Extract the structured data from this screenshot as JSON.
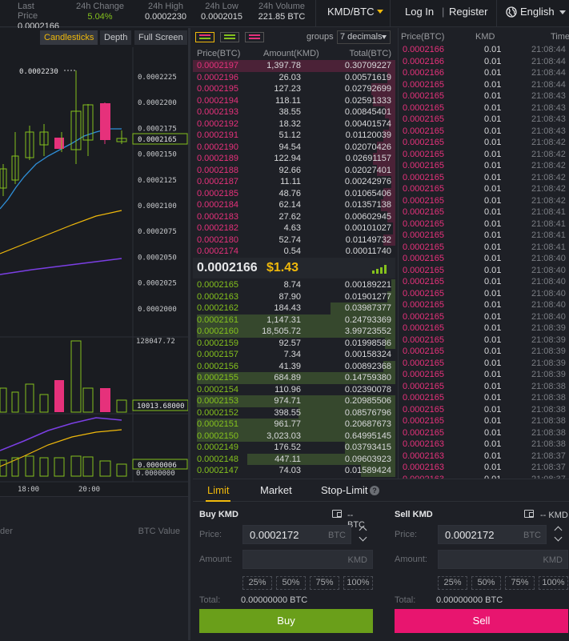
{
  "ticker": {
    "last_price_label": "Last Price",
    "last_price": "0.0002166",
    "change_label": "24h Change",
    "change": "5.04%",
    "high_label": "24h High",
    "high": "0.0002230",
    "low_label": "24h Low",
    "low": "0.0002015",
    "volume_label": "24h Volume",
    "volume": "221.85 BTC"
  },
  "pair": "KMD/BTC",
  "auth": {
    "login": "Log In",
    "separator": "|",
    "register": "Register"
  },
  "language": "English",
  "chart": {
    "toolbar": [
      "Candlesticks",
      "Depth",
      "Full Screen"
    ],
    "price_ticks": [
      "0.0002225",
      "0.0002200",
      "0.0002175",
      "0.0002150",
      "0.0002125",
      "0.0002100",
      "0.0002075",
      "0.0002050",
      "0.0002025",
      "0.0002000"
    ],
    "high_marker": "0.0002230",
    "last_marker": "0.0002165",
    "volume_max": "128047.72",
    "volume_marker": "10013.68000",
    "macd_marker": "0.0000006",
    "macd_zero": "0.0000000",
    "time_ticks": [
      "18:00",
      "20:00"
    ]
  },
  "bottom_left": {
    "col1": "der",
    "col2": "BTC Value"
  },
  "order_book": {
    "groups_label": "groups",
    "decimals": "7 decimals",
    "columns": {
      "price": "Price(BTC)",
      "amount": "Amount(KMD)",
      "total": "Total(BTC)"
    },
    "asks": [
      {
        "price": "0.0002197",
        "amount": "1,397.78",
        "total": "0.30709227",
        "depth": 1.0
      },
      {
        "price": "0.0002196",
        "amount": "26.03",
        "total": "0.00571619",
        "depth": 0.04
      },
      {
        "price": "0.0002195",
        "amount": "127.23",
        "total": "0.02792699",
        "depth": 0.12
      },
      {
        "price": "0.0002194",
        "amount": "118.11",
        "total": "0.02591333",
        "depth": 0.11
      },
      {
        "price": "0.0002193",
        "amount": "38.55",
        "total": "0.00845401",
        "depth": 0.05
      },
      {
        "price": "0.0002192",
        "amount": "18.32",
        "total": "0.00401574",
        "depth": 0.03
      },
      {
        "price": "0.0002191",
        "amount": "51.12",
        "total": "0.01120039",
        "depth": 0.06
      },
      {
        "price": "0.0002190",
        "amount": "94.54",
        "total": "0.02070426",
        "depth": 0.09
      },
      {
        "price": "0.0002189",
        "amount": "122.94",
        "total": "0.02691157",
        "depth": 0.11
      },
      {
        "price": "0.0002188",
        "amount": "92.66",
        "total": "0.02027401",
        "depth": 0.09
      },
      {
        "price": "0.0002187",
        "amount": "11.11",
        "total": "0.00242976",
        "depth": 0.02
      },
      {
        "price": "0.0002185",
        "amount": "48.76",
        "total": "0.01065406",
        "depth": 0.06
      },
      {
        "price": "0.0002184",
        "amount": "62.14",
        "total": "0.01357138",
        "depth": 0.07
      },
      {
        "price": "0.0002183",
        "amount": "27.62",
        "total": "0.00602945",
        "depth": 0.04
      },
      {
        "price": "0.0002182",
        "amount": "4.63",
        "total": "0.00101027",
        "depth": 0.01
      },
      {
        "price": "0.0002180",
        "amount": "52.74",
        "total": "0.01149732",
        "depth": 0.06
      },
      {
        "price": "0.0002174",
        "amount": "0.54",
        "total": "0.00011740",
        "depth": 0.0
      }
    ],
    "mid_price": "0.0002166",
    "mid_usd": "$1.43",
    "bids": [
      {
        "price": "0.0002165",
        "amount": "8.74",
        "total": "0.00189221",
        "depth": 0.02
      },
      {
        "price": "0.0002163",
        "amount": "87.90",
        "total": "0.01901277",
        "depth": 0.04
      },
      {
        "price": "0.0002162",
        "amount": "184.43",
        "total": "0.03987377",
        "depth": 0.32
      },
      {
        "price": "0.0002161",
        "amount": "1,147.31",
        "total": "0.24793369",
        "depth": 0.98
      },
      {
        "price": "0.0002160",
        "amount": "18,505.72",
        "total": "3.99723552",
        "depth": 0.98
      },
      {
        "price": "0.0002159",
        "amount": "92.57",
        "total": "0.01998586",
        "depth": 0.05
      },
      {
        "price": "0.0002157",
        "amount": "7.34",
        "total": "0.00158324",
        "depth": 0.0
      },
      {
        "price": "0.0002156",
        "amount": "41.39",
        "total": "0.00892368",
        "depth": 0.06
      },
      {
        "price": "0.0002155",
        "amount": "684.89",
        "total": "0.14759380",
        "depth": 0.98
      },
      {
        "price": "0.0002154",
        "amount": "110.96",
        "total": "0.02390078",
        "depth": 0.0
      },
      {
        "price": "0.0002153",
        "amount": "974.71",
        "total": "0.20985506",
        "depth": 0.98
      },
      {
        "price": "0.0002152",
        "amount": "398.55",
        "total": "0.08576796",
        "depth": 0.48
      },
      {
        "price": "0.0002151",
        "amount": "961.77",
        "total": "0.20687673",
        "depth": 0.98
      },
      {
        "price": "0.0002150",
        "amount": "3,023.03",
        "total": "0.64995145",
        "depth": 0.98
      },
      {
        "price": "0.0002149",
        "amount": "176.52",
        "total": "0.03793415",
        "depth": 0.25
      },
      {
        "price": "0.0002148",
        "amount": "447.11",
        "total": "0.09603923",
        "depth": 0.73
      },
      {
        "price": "0.0002147",
        "amount": "74.03",
        "total": "0.01589424",
        "depth": 0.17
      }
    ]
  },
  "trades": {
    "columns": {
      "price": "Price(BTC)",
      "amount": "KMD",
      "time": "Time"
    },
    "rows": [
      [
        "0.0002166",
        "0.01",
        "21:08:44"
      ],
      [
        "0.0002166",
        "0.01",
        "21:08:44"
      ],
      [
        "0.0002166",
        "0.01",
        "21:08:44"
      ],
      [
        "0.0002165",
        "0.01",
        "21:08:44"
      ],
      [
        "0.0002165",
        "0.01",
        "21:08:43"
      ],
      [
        "0.0002165",
        "0.01",
        "21:08:43"
      ],
      [
        "0.0002165",
        "0.01",
        "21:08:43"
      ],
      [
        "0.0002165",
        "0.01",
        "21:08:43"
      ],
      [
        "0.0002165",
        "0.01",
        "21:08:42"
      ],
      [
        "0.0002165",
        "0.01",
        "21:08:42"
      ],
      [
        "0.0002165",
        "0.01",
        "21:08:42"
      ],
      [
        "0.0002165",
        "0.01",
        "21:08:42"
      ],
      [
        "0.0002165",
        "0.01",
        "21:08:42"
      ],
      [
        "0.0002165",
        "0.01",
        "21:08:42"
      ],
      [
        "0.0002165",
        "0.01",
        "21:08:41"
      ],
      [
        "0.0002165",
        "0.01",
        "21:08:41"
      ],
      [
        "0.0002165",
        "0.01",
        "21:08:41"
      ],
      [
        "0.0002165",
        "0.01",
        "21:08:41"
      ],
      [
        "0.0002165",
        "0.01",
        "21:08:40"
      ],
      [
        "0.0002165",
        "0.01",
        "21:08:40"
      ],
      [
        "0.0002165",
        "0.01",
        "21:08:40"
      ],
      [
        "0.0002165",
        "0.01",
        "21:08:40"
      ],
      [
        "0.0002165",
        "0.01",
        "21:08:40"
      ],
      [
        "0.0002165",
        "0.01",
        "21:08:40"
      ],
      [
        "0.0002165",
        "0.01",
        "21:08:39"
      ],
      [
        "0.0002165",
        "0.01",
        "21:08:39"
      ],
      [
        "0.0002165",
        "0.01",
        "21:08:39"
      ],
      [
        "0.0002165",
        "0.01",
        "21:08:39"
      ],
      [
        "0.0002165",
        "0.01",
        "21:08:39"
      ],
      [
        "0.0002165",
        "0.01",
        "21:08:38"
      ],
      [
        "0.0002165",
        "0.01",
        "21:08:38"
      ],
      [
        "0.0002165",
        "0.01",
        "21:08:38"
      ],
      [
        "0.0002165",
        "0.01",
        "21:08:38"
      ],
      [
        "0.0002165",
        "0.01",
        "21:08:38"
      ],
      [
        "0.0002163",
        "0.01",
        "21:08:38"
      ],
      [
        "0.0002163",
        "0.01",
        "21:08:37"
      ],
      [
        "0.0002163",
        "0.01",
        "21:08:37"
      ],
      [
        "0.0002163",
        "0.01",
        "21:08:37"
      ],
      [
        "0.0002163",
        "0.01",
        "21:08:37"
      ]
    ]
  },
  "form": {
    "tabs": [
      "Limit",
      "Market",
      "Stop-Limit"
    ],
    "buy": {
      "title": "Buy KMD",
      "balance": "-- BTC",
      "price_label": "Price:",
      "price": "0.0002172",
      "price_unit": "BTC",
      "amount_label": "Amount:",
      "amount_unit": "KMD",
      "total_label": "Total:",
      "total": "0.00000000 BTC",
      "button": "Buy"
    },
    "sell": {
      "title": "Sell KMD",
      "balance": "-- KMD",
      "price_label": "Price:",
      "price": "0.0002172",
      "price_unit": "BTC",
      "amount_label": "Amount:",
      "amount_unit": "KMD",
      "total_label": "Total:",
      "total": "0.00000000 BTC",
      "button": "Sell"
    },
    "percents": [
      "25%",
      "50%",
      "75%",
      "100%"
    ]
  },
  "colors": {
    "accent": "#f0b90b",
    "up": "#84c11d",
    "down": "#e6317b",
    "buy": "#6a9f1a",
    "sell": "#e8156f"
  }
}
